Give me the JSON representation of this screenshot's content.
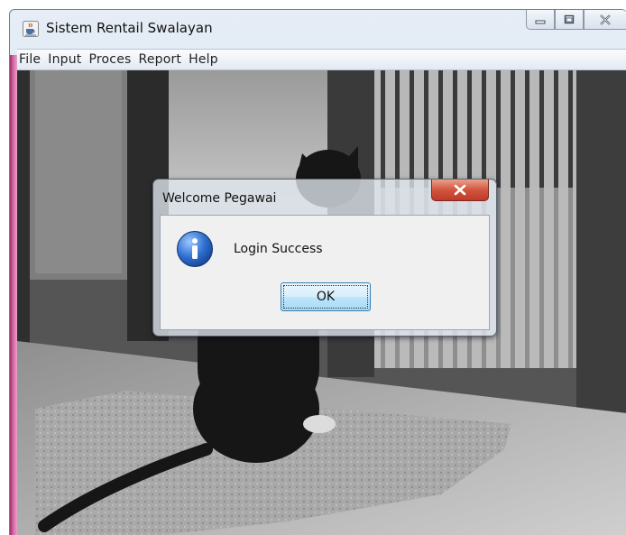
{
  "window": {
    "title": "Sistem Rentail Swalayan",
    "icon": "java-cup-icon",
    "controls": [
      "minimize-icon",
      "maximize-icon",
      "close-icon"
    ]
  },
  "menubar": {
    "items": [
      "File",
      "Input",
      "Proces",
      "Report",
      "Help"
    ]
  },
  "background": {
    "description_icon": "cat-photo"
  },
  "dialog": {
    "title": "Welcome Pegawai",
    "message": "Login Success",
    "icon": "info-icon",
    "ok_label": "OK"
  },
  "colors": {
    "close_button": "#c0392b",
    "ok_border": "#3c7fb1",
    "info_icon": "#1f5fbf",
    "menubar_bg": "#eef2f8"
  }
}
